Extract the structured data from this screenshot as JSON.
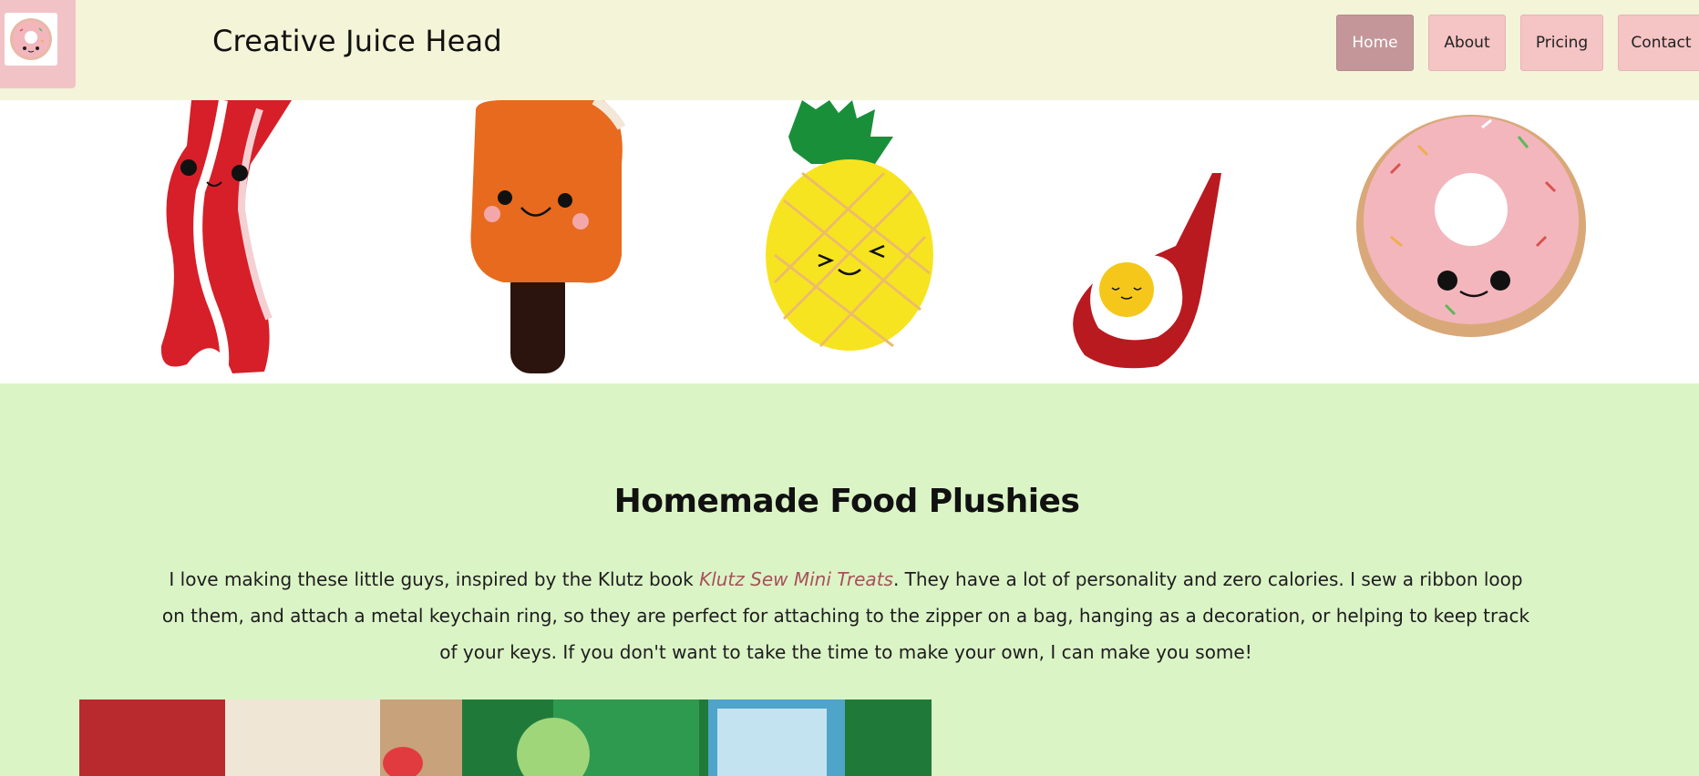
{
  "site": {
    "title": "Creative Juice Head"
  },
  "nav": {
    "items": [
      {
        "label": "Home",
        "active": true
      },
      {
        "label": "About",
        "active": false
      },
      {
        "label": "Pricing",
        "active": false
      },
      {
        "label": "Contact",
        "active": false
      }
    ]
  },
  "hero": {
    "plushies": [
      "bacon",
      "popsicle",
      "pineapple",
      "fried-egg-on-spatula",
      "donut"
    ]
  },
  "main": {
    "heading": "Homemade Food Plushies",
    "paragraph_before_link": "I love making these little guys, inspired by the Klutz book ",
    "book_link": "Klutz Sew Mini Treats",
    "paragraph_after_link": ". They have a lot of personality and zero calories. I sew a ribbon loop on them, and attach a metal keychain ring, so they are perfect for attaching to the zipper on a bag, hanging as a decoration, or helping to keep track of your keys. If you don't want to take the time to make your own, I can make you some!"
  },
  "colors": {
    "header_bg": "#f4f4d8",
    "content_bg": "#dbf4c6",
    "nav_bg": "#f5c4c5",
    "nav_active_bg": "#c4969a",
    "link": "#a8505c"
  }
}
